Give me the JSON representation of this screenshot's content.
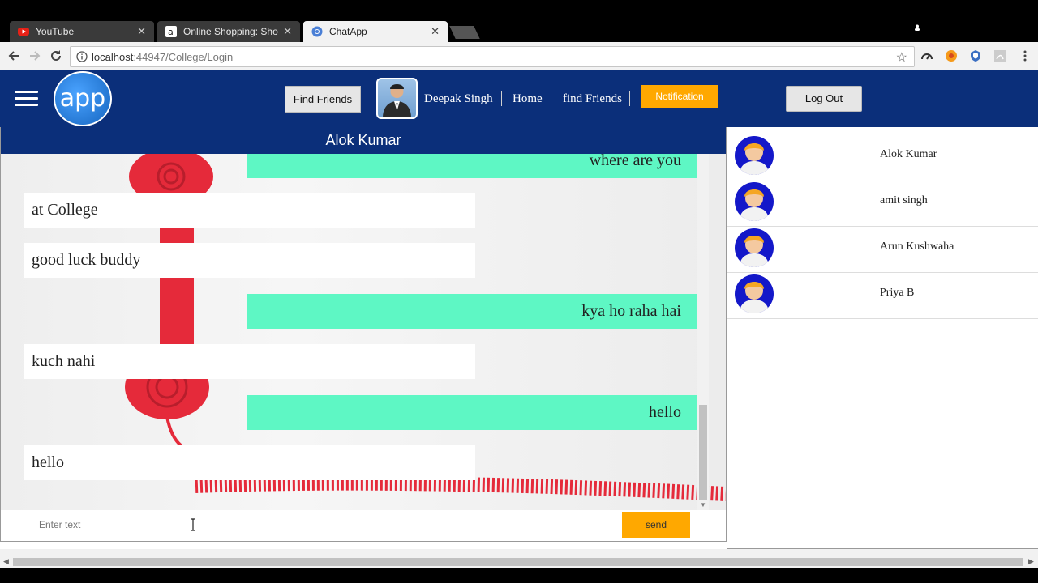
{
  "browser": {
    "tabs": [
      {
        "title": "YouTube",
        "icon": "youtube-icon"
      },
      {
        "title": "Online Shopping: Shop C",
        "icon": "amazon-icon"
      },
      {
        "title": "ChatApp",
        "icon": "chrome-icon"
      }
    ],
    "url_host": "localhost",
    "url_path": ":44947/College/Login"
  },
  "header": {
    "logo_text": "app",
    "find_friends_button": "Find Friends",
    "user_name": "Deepak Singh",
    "home_link": "Home",
    "find_friends_link": "find Friends",
    "notification_button": "Notification",
    "logout_button": "Log Out"
  },
  "chat": {
    "title": "Alok Kumar",
    "messages": [
      {
        "text": "where are you",
        "type": "sent"
      },
      {
        "text": "at College",
        "type": "received"
      },
      {
        "text": "good luck buddy",
        "type": "received"
      },
      {
        "text": "kya ho raha hai",
        "type": "sent"
      },
      {
        "text": "kuch nahi",
        "type": "received"
      },
      {
        "text": "hello",
        "type": "sent"
      },
      {
        "text": "hello",
        "type": "received"
      }
    ],
    "input_placeholder": "Enter text",
    "send_button": "send"
  },
  "friends": [
    {
      "name": "Alok Kumar"
    },
    {
      "name": "amit singh"
    },
    {
      "name": "Arun Kushwaha"
    },
    {
      "name": "Priya B"
    }
  ],
  "colors": {
    "header_bg": "#0b2f7a",
    "accent_orange": "#ffa800",
    "sent_bubble": "#5ef7c4",
    "received_bubble": "#ffffff"
  }
}
